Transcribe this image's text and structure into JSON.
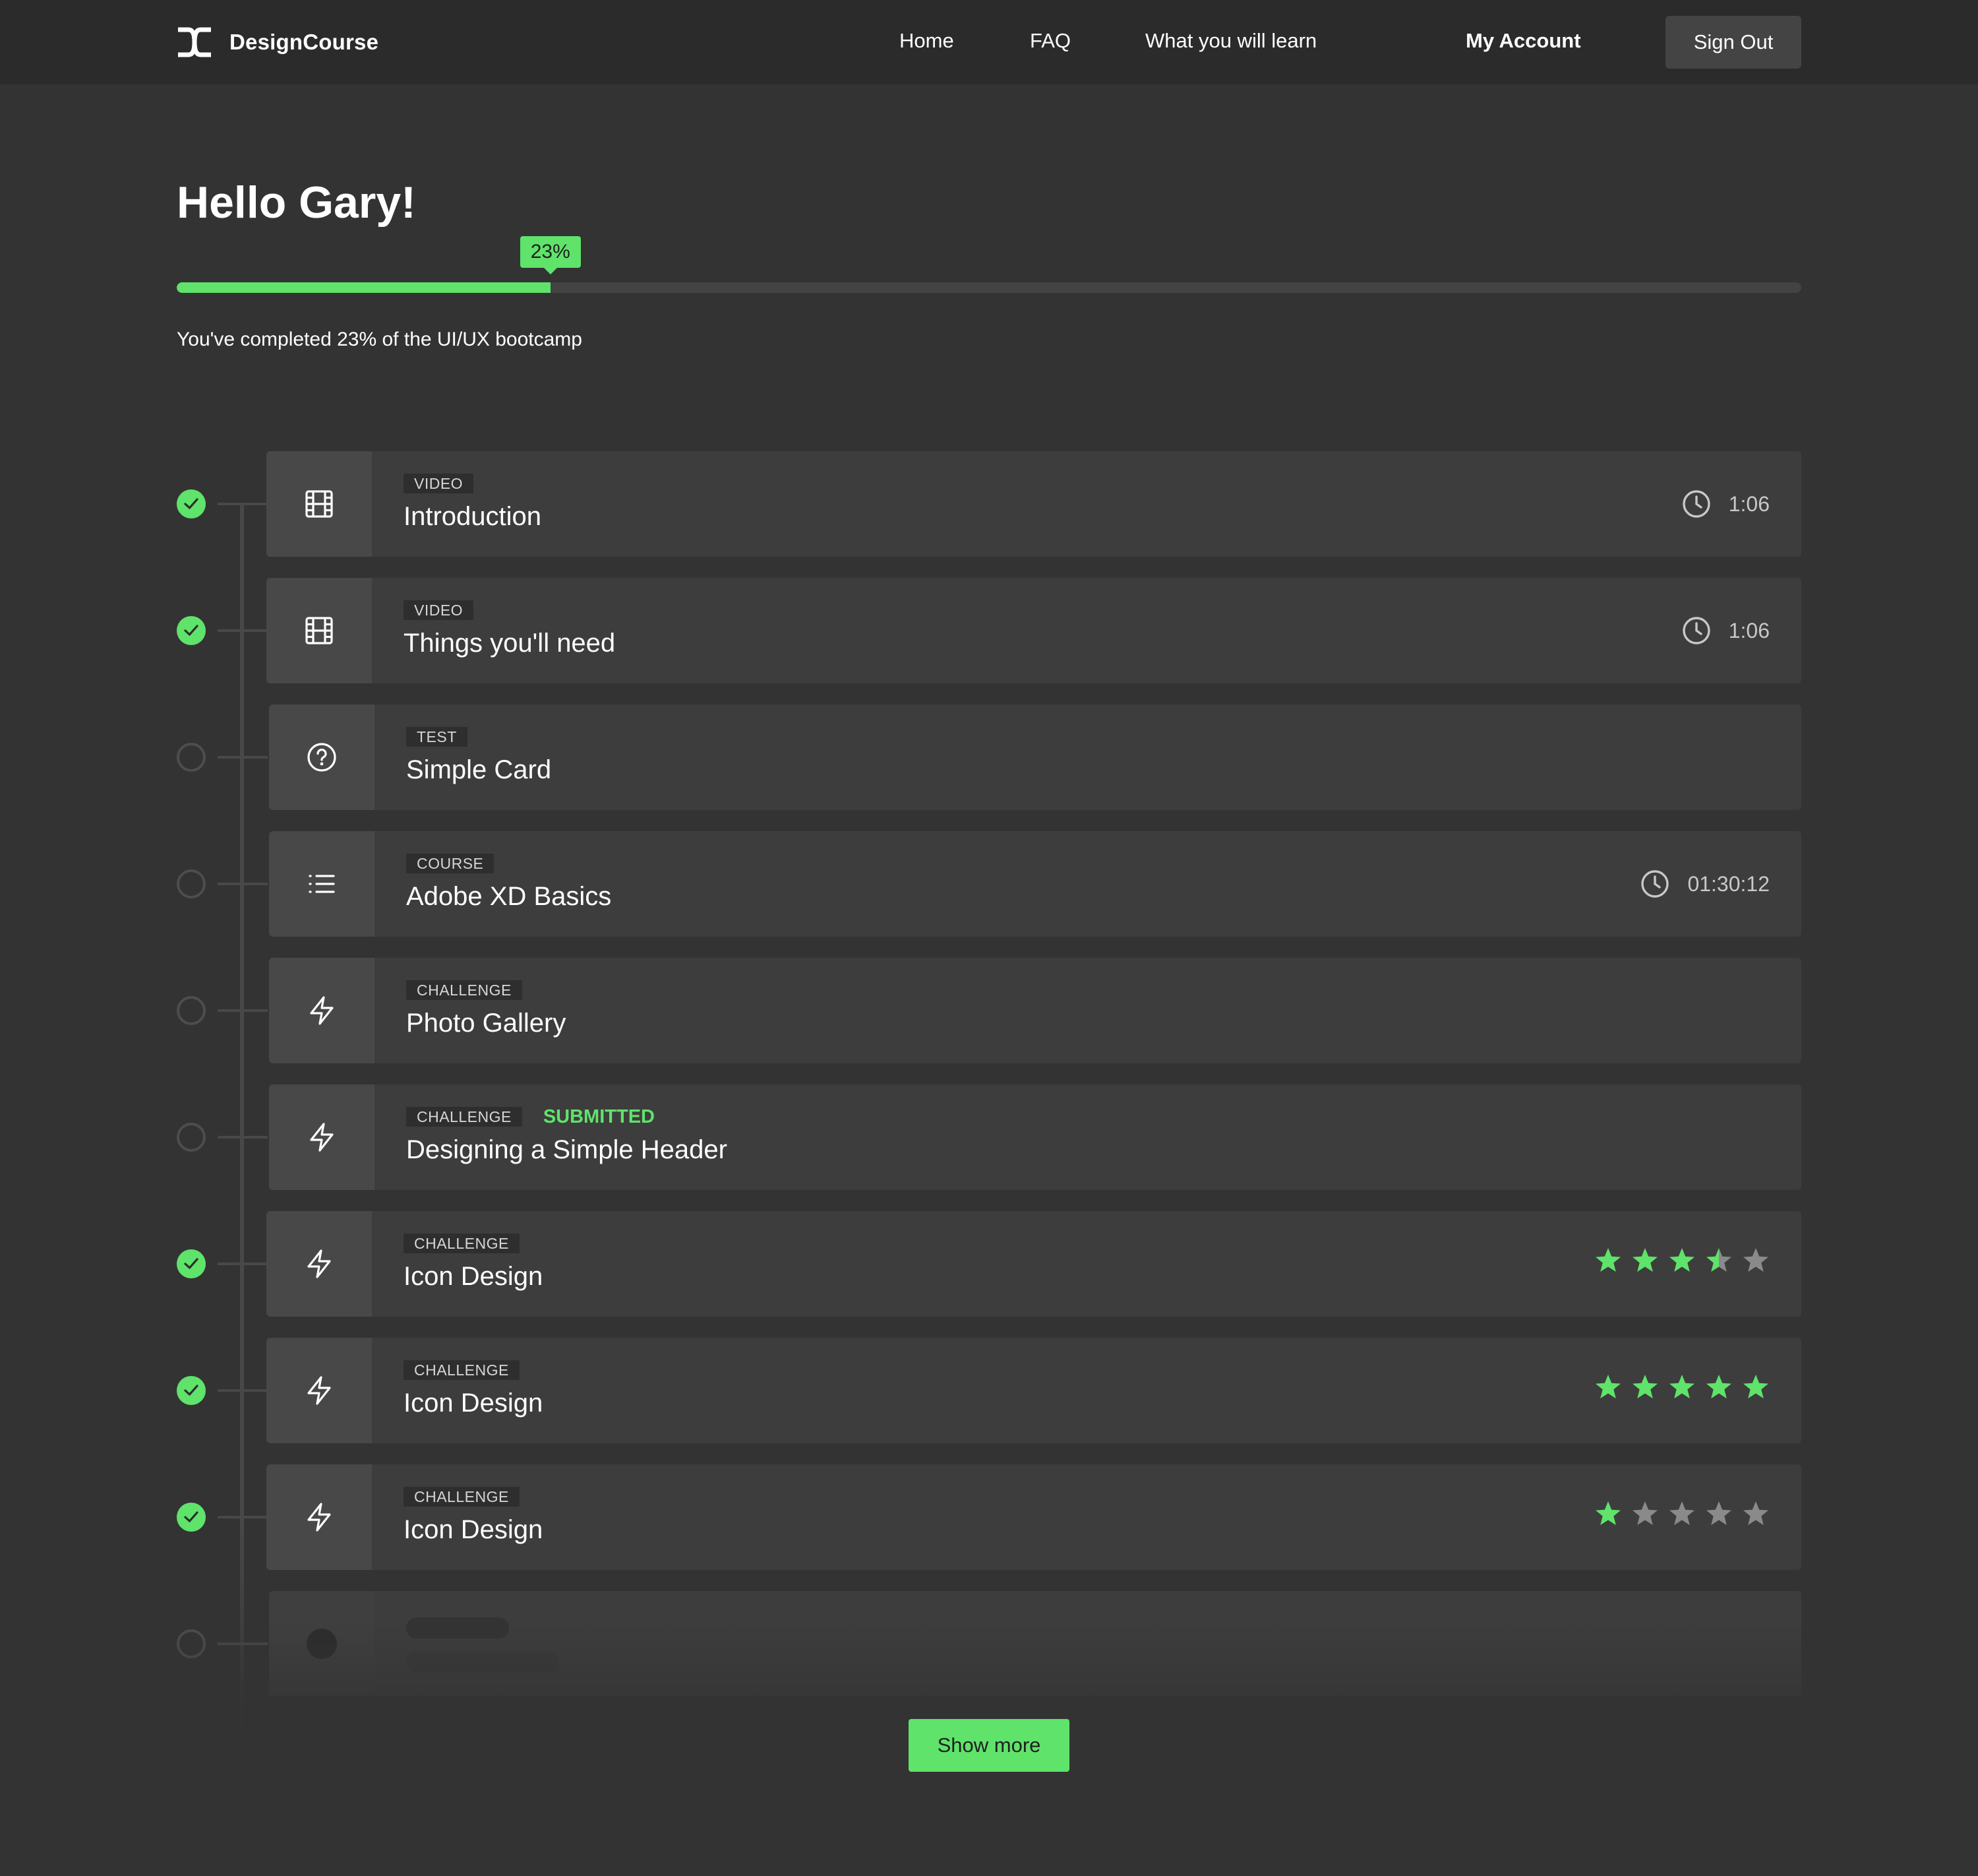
{
  "nav": {
    "brand": "DesignCourse",
    "links": [
      "Home",
      "FAQ",
      "What you will learn"
    ],
    "account": "My Account",
    "signout": "Sign Out"
  },
  "greeting": "Hello Gary!",
  "progress": {
    "percent": 23,
    "badge": "23%",
    "text": "You've completed 23% of the UI/UX bootcamp"
  },
  "lessons": [
    {
      "status": "done",
      "icon": "film-icon",
      "tag": "VIDEO",
      "title": "Introduction",
      "duration": "1:06"
    },
    {
      "status": "done",
      "icon": "film-icon",
      "tag": "VIDEO",
      "title": "Things you'll need",
      "duration": "1:06"
    },
    {
      "status": "pending",
      "icon": "question-circle-icon",
      "tag": "TEST",
      "title": "Simple Card"
    },
    {
      "status": "pending",
      "icon": "list-icon",
      "tag": "COURSE",
      "title": "Adobe XD Basics",
      "duration": "01:30:12"
    },
    {
      "status": "pending",
      "icon": "lightning-icon",
      "tag": "CHALLENGE",
      "title": "Photo Gallery"
    },
    {
      "status": "pending",
      "icon": "lightning-icon",
      "tag": "CHALLENGE",
      "submitted": "SUBMITTED",
      "title": "Designing a Simple Header"
    },
    {
      "status": "done",
      "icon": "lightning-icon",
      "tag": "CHALLENGE",
      "title": "Icon Design",
      "rating": 3.5
    },
    {
      "status": "done",
      "icon": "lightning-icon",
      "tag": "CHALLENGE",
      "title": "Icon Design",
      "rating": 5
    },
    {
      "status": "done",
      "icon": "lightning-icon",
      "tag": "CHALLENGE",
      "title": "Icon Design",
      "rating": 1
    }
  ],
  "show_more": "Show more",
  "colors": {
    "accent": "#5fe36b",
    "background": "#333333",
    "nav": "#2b2b2b",
    "card": "#3d3d3d",
    "star_empty": "#8a8a8a"
  }
}
